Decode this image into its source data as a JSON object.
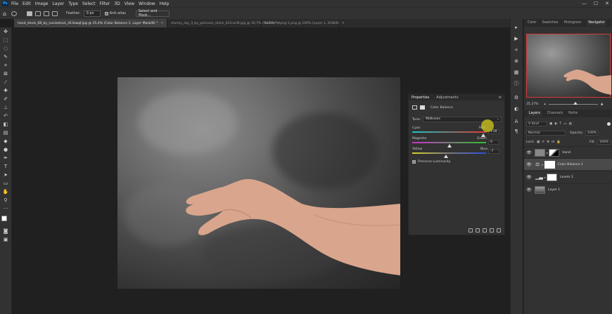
{
  "app": {
    "logo": "Ps"
  },
  "menu": [
    "File",
    "Edit",
    "Image",
    "Layer",
    "Type",
    "Select",
    "Filter",
    "3D",
    "View",
    "Window",
    "Help"
  ],
  "window_controls": [
    "—",
    "☐",
    "✕"
  ],
  "options_bar": {
    "feather_label": "Feather:",
    "feather_value": "0 px",
    "antialias_label": "Anti-alias",
    "select_mask_label": "Select and Mask..."
  },
  "tabs": [
    {
      "label": "hand_stock_68_by_nusiastock_d13zwqf.jpg @ 35,4% (Color Balance 1, Layer Mask/8) *",
      "active": true
    },
    {
      "label": "stormy_sky_3_by_pelicoon_stock_d22carl6.jpg @ 16,7% (RGB/8)",
      "active": false
    },
    {
      "label": "butterfly-png-1.png @ 100% (Layer 1, RGB/8)",
      "active": false
    }
  ],
  "properties": {
    "tabs": [
      "Properties",
      "Adjustments"
    ],
    "adjustment_title": "Color Balance",
    "tone_label": "Tone:",
    "tone_value": "Midtones",
    "sliders": [
      {
        "left": "Cyan",
        "right": "Red",
        "value": "+58"
      },
      {
        "left": "Magenta",
        "right": "Green",
        "value": "0"
      },
      {
        "left": "Yellow",
        "right": "Blue",
        "value": "-7"
      }
    ],
    "preserve_label": "Preserve Luminosity"
  },
  "navigator": {
    "tabs": [
      "Color",
      "Swatches",
      "Histogram",
      "Navigator"
    ],
    "zoom": "35,37%"
  },
  "layers_panel": {
    "tabs": [
      "Layers",
      "Channels",
      "Paths"
    ],
    "filter_label": "Kind",
    "blend_mode": "Normal",
    "opacity_label": "Opacity:",
    "opacity_value": "100%",
    "lock_label": "Lock:",
    "fill_label": "Fill:",
    "fill_value": "100%",
    "layers": [
      {
        "name": "hand",
        "selected": false
      },
      {
        "name": "Color Balance 1",
        "selected": true
      },
      {
        "name": "Levels 1",
        "selected": false
      },
      {
        "name": "Layer 1",
        "selected": false
      }
    ]
  },
  "colors": {
    "accent": "#31a8ff",
    "nav_frame": "#d83a3a"
  }
}
